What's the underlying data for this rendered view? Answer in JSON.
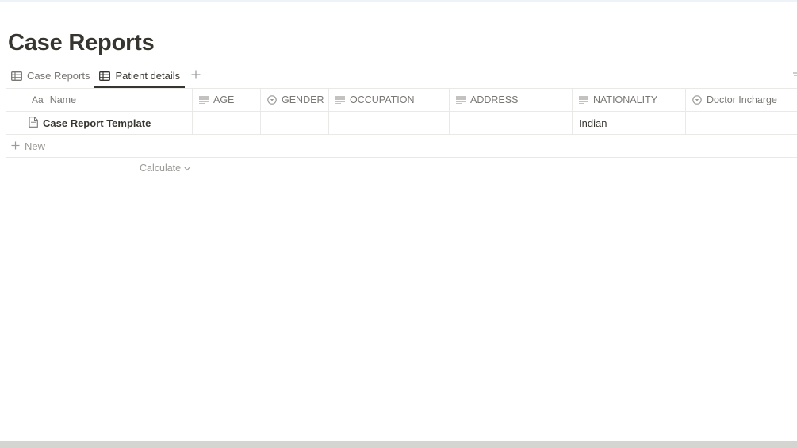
{
  "page": {
    "title": "Case Reports"
  },
  "tabs": [
    {
      "label": "Case Reports",
      "icon": "table-icon",
      "active": false
    },
    {
      "label": "Patient details",
      "icon": "table-icon",
      "active": true
    }
  ],
  "table": {
    "columns": [
      {
        "label": "Name",
        "type_icon": "Aa",
        "icon": "title-icon"
      },
      {
        "label": "AGE",
        "icon": "text-icon"
      },
      {
        "label": "GENDER",
        "icon": "select-icon"
      },
      {
        "label": "OCCUPATION",
        "icon": "text-icon"
      },
      {
        "label": "ADDRESS",
        "icon": "text-icon"
      },
      {
        "label": "NATIONALITY",
        "icon": "text-icon"
      },
      {
        "label": "Doctor Incharge",
        "icon": "select-icon"
      }
    ],
    "rows": [
      {
        "name": "Case Report Template",
        "age": "",
        "gender": "",
        "occupation": "",
        "address": "",
        "nationality": "Indian",
        "doctor_incharge": ""
      }
    ],
    "new_label": "New",
    "calculate_label": "Calculate"
  },
  "colors": {
    "text": "#37352f",
    "muted": "#787774",
    "border": "#e9e9e7"
  }
}
